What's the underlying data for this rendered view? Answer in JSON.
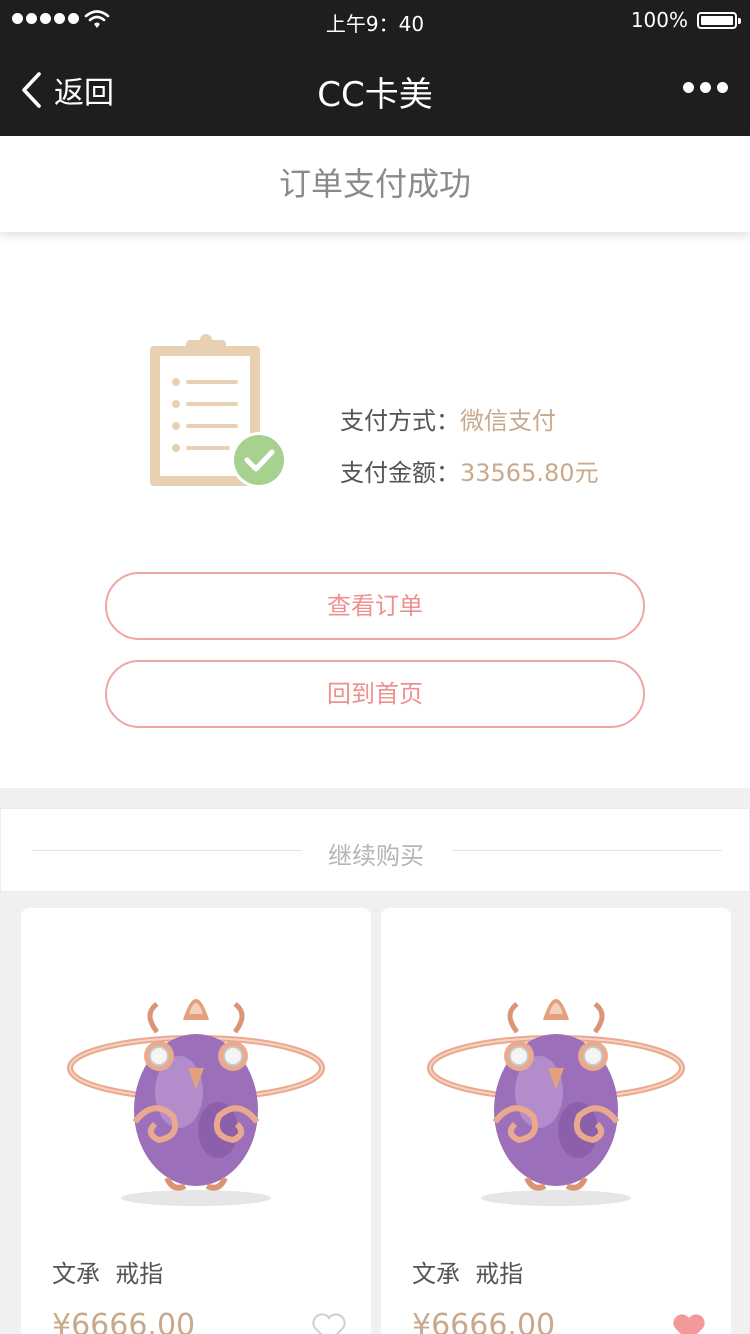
{
  "status_bar": {
    "time": "上午9：40",
    "battery": "100%"
  },
  "nav": {
    "back_label": "返回",
    "title": "CC卡美"
  },
  "page": {
    "title": "订单支付成功"
  },
  "payment": {
    "method_label": "支付方式：",
    "method_value": "微信支付",
    "amount_label": "支付金额：",
    "amount_value": "33565.80元"
  },
  "buttons": {
    "view_order": "查看订单",
    "go_home": "回到首页"
  },
  "continue_section": {
    "label": "继续购买"
  },
  "products": [
    {
      "name": "文承  戒指",
      "price": "¥6666.00",
      "favorited": false
    },
    {
      "name": "文承  戒指",
      "price": "¥6666.00",
      "favorited": true
    }
  ],
  "colors": {
    "accent_pink": "#ee9090",
    "gold": "#c9a98c",
    "success_green": "#a7d18e",
    "nav_bg": "#1e1e1e"
  }
}
